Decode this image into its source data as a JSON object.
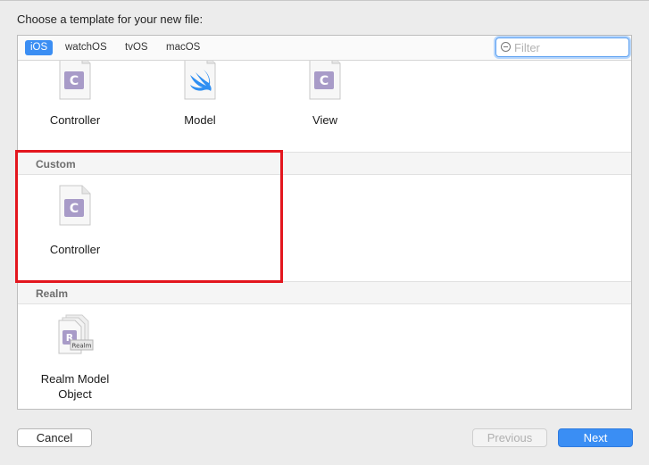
{
  "prompt": "Choose a template for your new file:",
  "tabs": [
    {
      "label": "iOS",
      "selected": true
    },
    {
      "label": "watchOS",
      "selected": false
    },
    {
      "label": "tvOS",
      "selected": false
    },
    {
      "label": "macOS",
      "selected": false
    }
  ],
  "filter": {
    "placeholder": "Filter",
    "value": ""
  },
  "top_row": [
    {
      "label": "Controller",
      "icon": "c-source-file-icon"
    },
    {
      "label": "Model",
      "icon": "swift-file-icon"
    },
    {
      "label": "View",
      "icon": "c-source-file-icon"
    }
  ],
  "sections": [
    {
      "title": "Custom",
      "items": [
        {
          "label": "Controller",
          "icon": "c-source-file-icon"
        }
      ]
    },
    {
      "title": "Realm",
      "items": [
        {
          "label": "Realm Model Object",
          "icon": "realm-model-icon"
        }
      ]
    }
  ],
  "buttons": {
    "cancel": "Cancel",
    "previous": "Previous",
    "next": "Next"
  },
  "colors": {
    "accent": "#3b8ef3",
    "highlight_border": "#e3161e",
    "c_badge": "#a89bc8",
    "swift": "#2f8ff2"
  }
}
